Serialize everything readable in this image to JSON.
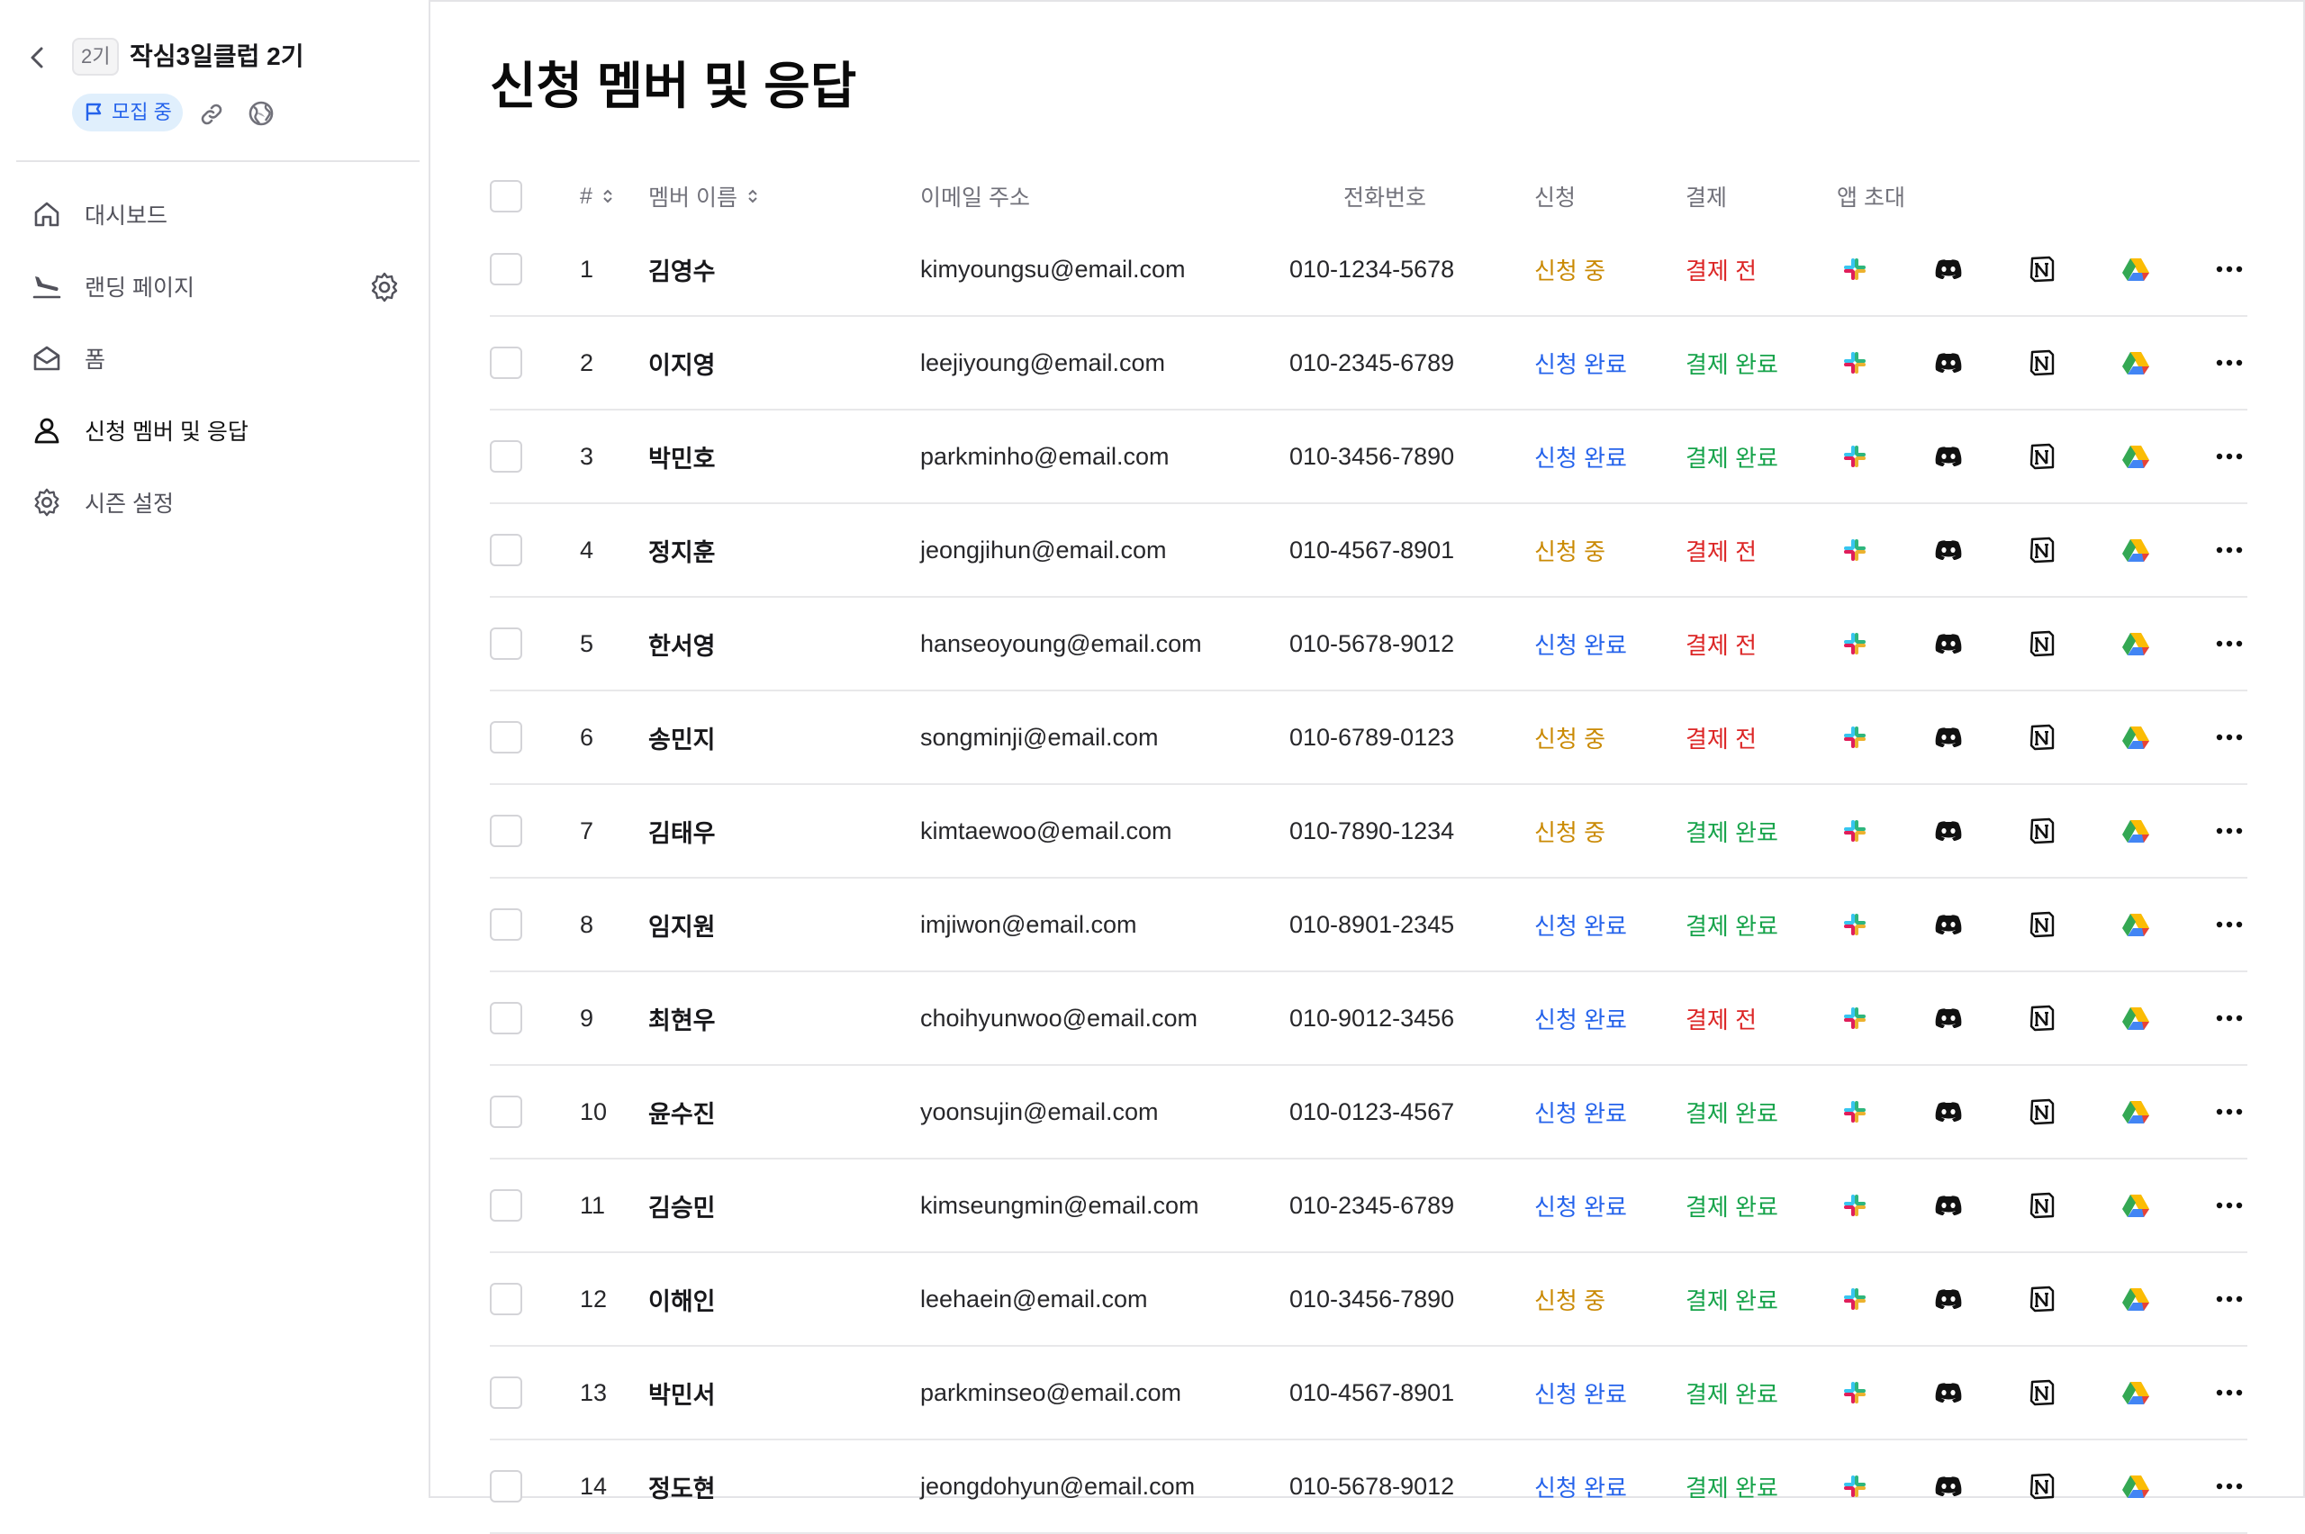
{
  "sidebar": {
    "season_badge": "2기",
    "club_title": "작심3일클럽 2기",
    "status_label": "모집 중",
    "items": [
      {
        "label": "대시보드",
        "icon": "home-icon"
      },
      {
        "label": "랜딩 페이지",
        "icon": "landing-plane-icon"
      },
      {
        "label": "폼",
        "icon": "mail-open-icon"
      },
      {
        "label": "신청 멤버 및 응답",
        "icon": "user-icon"
      },
      {
        "label": "시즌 설정",
        "icon": "gear-icon"
      }
    ]
  },
  "page": {
    "title": "신청 멤버 및 응답"
  },
  "table": {
    "headers": {
      "num": "#",
      "name": "멤버 이름",
      "email": "이메일 주소",
      "phone": "전화번호",
      "apply": "신청",
      "payment": "결제",
      "apps": "앱 초대"
    },
    "rows": [
      {
        "num": "1",
        "name": "김영수",
        "email": "kimyoungsu@email.com",
        "phone": "010-1234-5678",
        "apply": "신청 중",
        "payment": "결제 전"
      },
      {
        "num": "2",
        "name": "이지영",
        "email": "leejiyoung@email.com",
        "phone": "010-2345-6789",
        "apply": "신청 완료",
        "payment": "결제 완료"
      },
      {
        "num": "3",
        "name": "박민호",
        "email": "parkminho@email.com",
        "phone": "010-3456-7890",
        "apply": "신청 완료",
        "payment": "결제 완료"
      },
      {
        "num": "4",
        "name": "정지훈",
        "email": "jeongjihun@email.com",
        "phone": "010-4567-8901",
        "apply": "신청 중",
        "payment": "결제 전"
      },
      {
        "num": "5",
        "name": "한서영",
        "email": "hanseoyoung@email.com",
        "phone": "010-5678-9012",
        "apply": "신청 완료",
        "payment": "결제 전"
      },
      {
        "num": "6",
        "name": "송민지",
        "email": "songminji@email.com",
        "phone": "010-6789-0123",
        "apply": "신청 중",
        "payment": "결제 전"
      },
      {
        "num": "7",
        "name": "김태우",
        "email": "kimtaewoo@email.com",
        "phone": "010-7890-1234",
        "apply": "신청 중",
        "payment": "결제 완료"
      },
      {
        "num": "8",
        "name": "임지원",
        "email": "imjiwon@email.com",
        "phone": "010-8901-2345",
        "apply": "신청 완료",
        "payment": "결제 완료"
      },
      {
        "num": "9",
        "name": "최현우",
        "email": "choihyunwoo@email.com",
        "phone": "010-9012-3456",
        "apply": "신청 완료",
        "payment": "결제 전"
      },
      {
        "num": "10",
        "name": "윤수진",
        "email": "yoonsujin@email.com",
        "phone": "010-0123-4567",
        "apply": "신청 완료",
        "payment": "결제 완료"
      },
      {
        "num": "11",
        "name": "김승민",
        "email": "kimseungmin@email.com",
        "phone": "010-2345-6789",
        "apply": "신청 완료",
        "payment": "결제 완료"
      },
      {
        "num": "12",
        "name": "이해인",
        "email": "leehaein@email.com",
        "phone": "010-3456-7890",
        "apply": "신청 중",
        "payment": "결제 완료"
      },
      {
        "num": "13",
        "name": "박민서",
        "email": "parkminseo@email.com",
        "phone": "010-4567-8901",
        "apply": "신청 완료",
        "payment": "결제 완료"
      },
      {
        "num": "14",
        "name": "정도현",
        "email": "jeongdohyun@email.com",
        "phone": "010-5678-9012",
        "apply": "신청 완료",
        "payment": "결제 완료"
      }
    ]
  },
  "colors": {
    "apply_in_progress": "#ca8a04",
    "apply_done": "#2563eb",
    "payment_before": "#dc2626",
    "payment_done": "#16a34a",
    "status_chip_bg": "#e0effc"
  },
  "app_icons": [
    "slack-icon",
    "discord-icon",
    "notion-icon",
    "google-drive-icon"
  ]
}
